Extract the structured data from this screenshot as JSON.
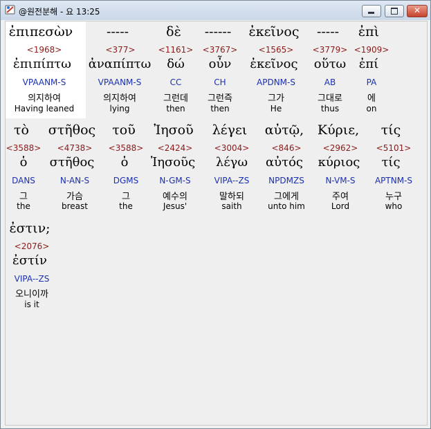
{
  "window": {
    "title": "@원전분해 - 요 13:25",
    "icon": "app-bible-icon",
    "controls": {
      "minimize": "minimize-icon",
      "maximize": "maximize-icon",
      "close": "✕"
    }
  },
  "rows": [
    {
      "words": [
        {
          "greek": "ἐπιπεσὼν",
          "strong": "<1968>",
          "lemma": "ἐπιπίπτω",
          "parse": "VPAANM-S",
          "korean": "의지하여",
          "english": "Having leaned"
        },
        {
          "greek": "-----",
          "strong": "<377>",
          "lemma": "ἀναπίπτω",
          "parse": "VPAANM-S",
          "korean": "의지하여",
          "english": "lying"
        },
        {
          "greek": "δὲ",
          "strong": "<1161>",
          "lemma": "δώ",
          "parse": "CC",
          "korean": "그런데",
          "english": "then"
        },
        {
          "greek": "------",
          "strong": "<3767>",
          "lemma": "οὖν",
          "parse": "CH",
          "korean": "그런즉",
          "english": "then"
        },
        {
          "greek": "ἐκεῖνος",
          "strong": "<1565>",
          "lemma": "ἐκεῖνος",
          "parse": "APDNM-S",
          "korean": "그가",
          "english": "He"
        },
        {
          "greek": "-----",
          "strong": "<3779>",
          "lemma": "οὕτω",
          "parse": "AB",
          "korean": "그대로",
          "english": "thus"
        },
        {
          "greek": "ἐπὶ",
          "strong": "<1909>",
          "lemma": "ἐπί",
          "parse": "PA",
          "korean": "에",
          "english": "on"
        }
      ]
    },
    {
      "words": [
        {
          "greek": "τὸ",
          "strong": "<3588>",
          "lemma": "ὁ",
          "parse": "DANS",
          "korean": "그",
          "english": "the"
        },
        {
          "greek": "στῆθος",
          "strong": "<4738>",
          "lemma": "στῆθος",
          "parse": "N-AN-S",
          "korean": "가슴",
          "english": "breast"
        },
        {
          "greek": "τοῦ",
          "strong": "<3588>",
          "lemma": "ὁ",
          "parse": "DGMS",
          "korean": "그",
          "english": "the"
        },
        {
          "greek": "Ἰησοῦ",
          "strong": "<2424>",
          "lemma": "Ἰησοῦς",
          "parse": "N-GM-S",
          "korean": "예수의",
          "english": "Jesus'"
        },
        {
          "greek": "λέγει",
          "strong": "<3004>",
          "lemma": "λέγω",
          "parse": "VIPA--ZS",
          "korean": "말하되",
          "english": "saith"
        },
        {
          "greek": "αὐτῷ,",
          "strong": "<846>",
          "lemma": "αὐτός",
          "parse": "NPDMZS",
          "korean": "그에게",
          "english": "unto him"
        },
        {
          "greek": "Κύριε,",
          "strong": "<2962>",
          "lemma": "κύριος",
          "parse": "N-VM-S",
          "korean": "주여",
          "english": "Lord"
        },
        {
          "greek": "τίς",
          "strong": "<5101>",
          "lemma": "τίς",
          "parse": "APTNM-S",
          "korean": "누구",
          "english": "who"
        }
      ]
    },
    {
      "words": [
        {
          "greek": "ἐστιν;",
          "strong": "<2076>",
          "lemma": "ἐστίν",
          "parse": "VIPA--ZS",
          "korean": "오니이까",
          "english": "is it"
        }
      ]
    }
  ]
}
